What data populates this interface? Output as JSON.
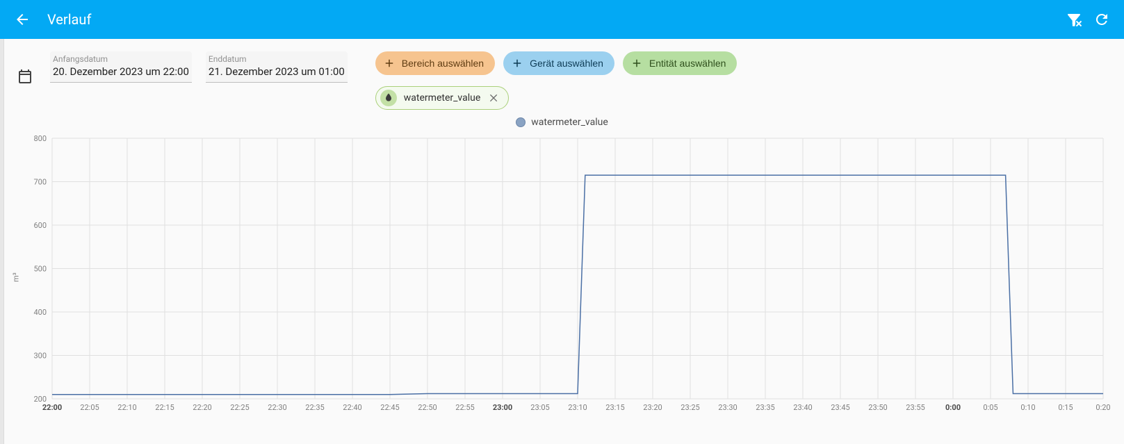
{
  "header": {
    "title": "Verlauf"
  },
  "dates": {
    "start_label": "Anfangsdatum",
    "start_value": "20. Dezember 2023 um 22:00",
    "end_label": "Enddatum",
    "end_value": "21. Dezember 2023 um 01:00"
  },
  "chips": {
    "area": "Bereich auswählen",
    "device": "Gerät auswählen",
    "entity": "Entität auswählen"
  },
  "selected_entity": {
    "name": "watermeter_value"
  },
  "legend": {
    "label": "watermeter_value",
    "color": "#8aa3c3"
  },
  "chart_data": {
    "type": "line",
    "ylabel": "m³",
    "ylim": [
      200,
      800
    ],
    "y_ticks": [
      200,
      300,
      400,
      500,
      600,
      700,
      800
    ],
    "x_ticks": [
      "22:00",
      "22:05",
      "22:10",
      "22:15",
      "22:20",
      "22:25",
      "22:30",
      "22:35",
      "22:40",
      "22:45",
      "22:50",
      "22:55",
      "23:00",
      "23:05",
      "23:10",
      "23:15",
      "23:20",
      "23:25",
      "23:30",
      "23:35",
      "23:40",
      "23:45",
      "23:50",
      "23:55",
      "0:00",
      "0:05",
      "0:10",
      "0:15",
      "0:20"
    ],
    "x_bold": [
      "22:00",
      "23:00",
      "0:00"
    ],
    "series": [
      {
        "name": "watermeter_value",
        "color": "#4a6fa5",
        "points": [
          {
            "x": "22:00",
            "y": 210
          },
          {
            "x": "22:05",
            "y": 210
          },
          {
            "x": "22:10",
            "y": 210
          },
          {
            "x": "22:15",
            "y": 210
          },
          {
            "x": "22:20",
            "y": 210
          },
          {
            "x": "22:25",
            "y": 210
          },
          {
            "x": "22:30",
            "y": 210
          },
          {
            "x": "22:35",
            "y": 210
          },
          {
            "x": "22:40",
            "y": 210
          },
          {
            "x": "22:45",
            "y": 210
          },
          {
            "x": "22:50",
            "y": 212
          },
          {
            "x": "22:55",
            "y": 212
          },
          {
            "x": "23:00",
            "y": 212
          },
          {
            "x": "23:05",
            "y": 212
          },
          {
            "x": "23:10",
            "y": 212
          },
          {
            "x": "23:11",
            "y": 715
          },
          {
            "x": "23:15",
            "y": 715
          },
          {
            "x": "23:20",
            "y": 715
          },
          {
            "x": "23:25",
            "y": 715
          },
          {
            "x": "23:30",
            "y": 715
          },
          {
            "x": "23:35",
            "y": 715
          },
          {
            "x": "23:40",
            "y": 715
          },
          {
            "x": "23:45",
            "y": 715
          },
          {
            "x": "23:50",
            "y": 715
          },
          {
            "x": "23:55",
            "y": 715
          },
          {
            "x": "0:00",
            "y": 715
          },
          {
            "x": "0:05",
            "y": 715
          },
          {
            "x": "0:07",
            "y": 715
          },
          {
            "x": "0:08",
            "y": 212
          },
          {
            "x": "0:10",
            "y": 212
          },
          {
            "x": "0:15",
            "y": 212
          },
          {
            "x": "0:20",
            "y": 212
          }
        ]
      }
    ]
  }
}
